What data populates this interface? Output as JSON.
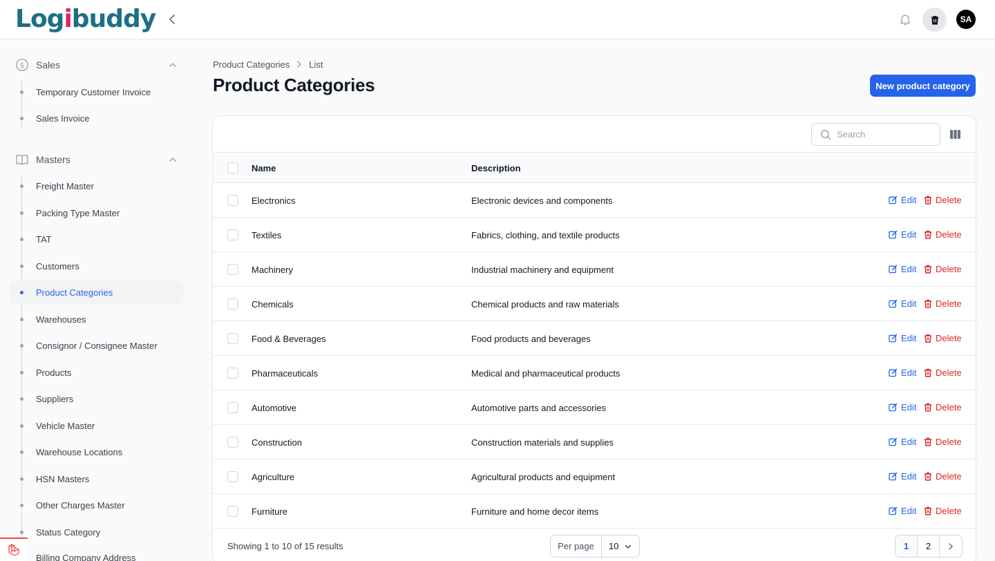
{
  "app": {
    "logo_text": "Logibuddy",
    "user_initials": "SA"
  },
  "colors": {
    "primary": "#2563eb",
    "danger": "#dc2626",
    "brand": "#1b6f86",
    "brand_accent": "#e0245e"
  },
  "sidebar": {
    "groups": [
      {
        "label": "Sales",
        "icon": "dollar-circle-icon",
        "items": [
          {
            "label": "Temporary Customer Invoice"
          },
          {
            "label": "Sales Invoice"
          }
        ]
      },
      {
        "label": "Masters",
        "icon": "book-icon",
        "items": [
          {
            "label": "Freight Master"
          },
          {
            "label": "Packing Type Master"
          },
          {
            "label": "TAT"
          },
          {
            "label": "Customers"
          },
          {
            "label": "Product Categories",
            "active": true
          },
          {
            "label": "Warehouses"
          },
          {
            "label": "Consignor / Consignee Master"
          },
          {
            "label": "Products"
          },
          {
            "label": "Suppliers"
          },
          {
            "label": "Vehicle Master"
          },
          {
            "label": "Warehouse Locations"
          },
          {
            "label": "HSN Masters"
          },
          {
            "label": "Other Charges Master"
          },
          {
            "label": "Status Category"
          },
          {
            "label": "Billing Company Address"
          }
        ]
      }
    ]
  },
  "breadcrumb": [
    "Product Categories",
    "List"
  ],
  "page": {
    "title": "Product Categories",
    "new_button": "New product category"
  },
  "search": {
    "placeholder": "Search",
    "value": ""
  },
  "table": {
    "columns": [
      "Name",
      "Description"
    ],
    "edit_label": "Edit",
    "delete_label": "Delete",
    "rows": [
      {
        "name": "Electronics",
        "description": "Electronic devices and components"
      },
      {
        "name": "Textiles",
        "description": "Fabrics, clothing, and textile products"
      },
      {
        "name": "Machinery",
        "description": "Industrial machinery and equipment"
      },
      {
        "name": "Chemicals",
        "description": "Chemical products and raw materials"
      },
      {
        "name": "Food & Beverages",
        "description": "Food products and beverages"
      },
      {
        "name": "Pharmaceuticals",
        "description": "Medical and pharmaceutical products"
      },
      {
        "name": "Automotive",
        "description": "Automotive parts and accessories"
      },
      {
        "name": "Construction",
        "description": "Construction materials and supplies"
      },
      {
        "name": "Agriculture",
        "description": "Agricultural products and equipment"
      },
      {
        "name": "Furniture",
        "description": "Furniture and home decor items"
      }
    ]
  },
  "footer": {
    "showing": "Showing 1 to 10 of 15 results",
    "per_page_label": "Per page",
    "per_page_value": "10",
    "pages": [
      "1",
      "2"
    ],
    "current_page": "1"
  }
}
